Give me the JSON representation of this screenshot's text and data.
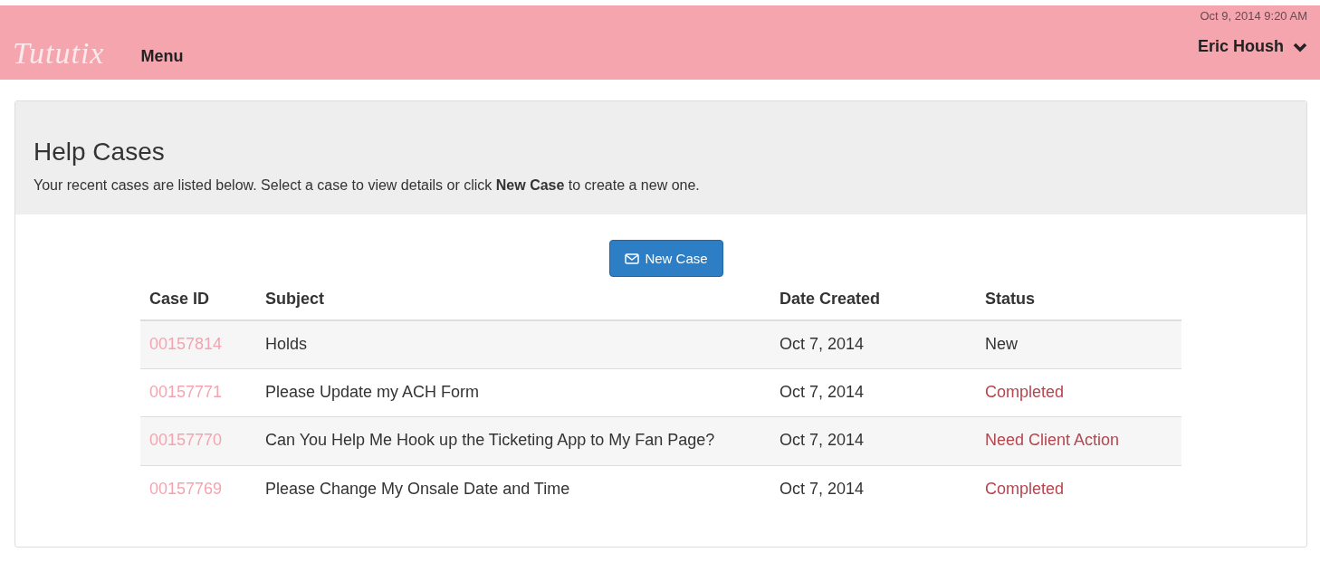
{
  "header": {
    "logo": "Tututix",
    "menu": "Menu",
    "datetime": "Oct 9, 2014 9:20 AM",
    "user": "Eric Housh"
  },
  "page": {
    "title": "Help Cases",
    "intro": "Your recent cases are listed below. Select a case to view details or click **New Case** to create a new one."
  },
  "new_case_button": {
    "label": "New Case"
  },
  "table": {
    "columns": [
      "Case ID",
      "Subject",
      "Date Created",
      "Status"
    ],
    "rows": [
      {
        "case_id": "00157814",
        "subject": "Holds",
        "date": "Oct 7, 2014",
        "status": "New",
        "color": "#333333"
      },
      {
        "case_id": "00157771",
        "subject": "Please Update my ACH Form",
        "date": "Oct 7, 2014",
        "status": "Completed",
        "color": "#b5454f"
      },
      {
        "case_id": "00157770",
        "subject": "Can You Help Me Hook up the Ticketing App to My Fan Page?",
        "date": "Oct 7, 2014",
        "status": "Need Client Action",
        "color": "#b5454f"
      },
      {
        "case_id": "00157769",
        "subject": "Please Change My Onsale Date and Time",
        "date": "Oct 7, 2014",
        "status": "Completed",
        "color": "#b5454f"
      }
    ]
  }
}
